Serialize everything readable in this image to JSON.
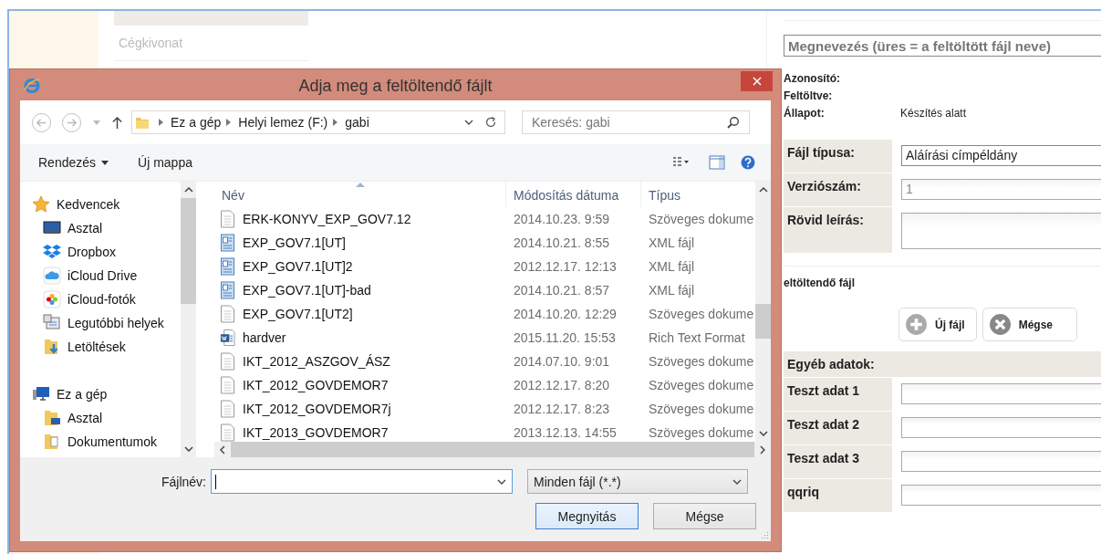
{
  "page": {
    "side_list": [
      {
        "label": "Cégkivonat"
      }
    ],
    "form": {
      "name_field": {
        "placeholder": "Megnevezés (üres = a feltöltött fájl neve)"
      },
      "info": [
        {
          "label": "Azonosító:"
        },
        {
          "label": "Feltöltve:"
        },
        {
          "label": "Állapot:",
          "value": "Készítés alatt"
        }
      ],
      "fields": [
        {
          "label": "Fájl típusa:",
          "kind": "select",
          "value": "Aláírási címpéldány"
        },
        {
          "label": "Verziószám:",
          "kind": "input",
          "value": "1"
        },
        {
          "label": "Rövid leírás:",
          "kind": "textarea"
        }
      ],
      "upload_label": "eltöltendő fájl",
      "upload_buttons": [
        {
          "label": "Új fájl",
          "kind": "add"
        },
        {
          "label": "Mégse",
          "kind": "cancel"
        }
      ],
      "extra_header": "Egyéb adatok:",
      "extra_fields": [
        {
          "label": "Teszt adat 1"
        },
        {
          "label": "Teszt adat 2"
        },
        {
          "label": "Teszt adat 3"
        },
        {
          "label": "qqriq"
        }
      ]
    }
  },
  "dialog": {
    "title": "Adja meg a feltöltendő fájlt",
    "breadcrumbs": [
      "Ez a gép",
      "Helyi lemez (F:)",
      "gabi"
    ],
    "search": {
      "placeholder": "Keresés: gabi"
    },
    "toolbar": [
      {
        "label": "Rendezés",
        "kind": "menu"
      },
      {
        "label": "Új mappa",
        "kind": "plain"
      }
    ],
    "nav": [
      {
        "label": "Kedvencek",
        "kind": "star",
        "children": [
          {
            "label": "Asztal",
            "kind": "desktop"
          },
          {
            "label": "Dropbox",
            "kind": "dropbox"
          },
          {
            "label": "iCloud Drive",
            "kind": "cloud"
          },
          {
            "label": "iCloud-fotók",
            "kind": "photos"
          },
          {
            "label": "Legutóbbi helyek",
            "kind": "recent"
          },
          {
            "label": "Letöltések",
            "kind": "downloads"
          }
        ]
      },
      {
        "label": "Ez a gép",
        "kind": "computer",
        "children": [
          {
            "label": "Asztal",
            "kind": "folder"
          },
          {
            "label": "Dokumentumok",
            "kind": "documents"
          }
        ]
      }
    ],
    "columns": [
      "Név",
      "Módosítás dátuma",
      "Típus"
    ],
    "files": [
      {
        "name": "ERK-KONYV_EXP_GOV7.12",
        "date": "2014.10.23. 9:59",
        "type": "Szöveges dokume",
        "kind": "text"
      },
      {
        "name": "EXP_GOV7.1[UT]",
        "date": "2014.10.21. 8:55",
        "type": "XML fájl",
        "kind": "xml"
      },
      {
        "name": "EXP_GOV7.1[UT]2",
        "date": "2012.12.17. 12:13",
        "type": "XML fájl",
        "kind": "xml"
      },
      {
        "name": "EXP_GOV7.1[UT]-bad",
        "date": "2014.10.21. 8:57",
        "type": "XML fájl",
        "kind": "xml"
      },
      {
        "name": "EXP_GOV7.1[UT2]",
        "date": "2014.10.20. 12:29",
        "type": "Szöveges dokume",
        "kind": "text"
      },
      {
        "name": "hardver",
        "date": "2015.11.20. 15:53",
        "type": "Rich Text Format",
        "kind": "word"
      },
      {
        "name": "IKT_2012_ASZGOV_ÁSZ",
        "date": "2014.07.10. 9:01",
        "type": "Szöveges dokume",
        "kind": "text"
      },
      {
        "name": "IKT_2012_GOVDEMOR7",
        "date": "2012.12.17. 8:20",
        "type": "Szöveges dokume",
        "kind": "text"
      },
      {
        "name": "IKT_2012_GOVDEMOR7j",
        "date": "2012.12.17. 8:23",
        "type": "Szöveges dokume",
        "kind": "text"
      },
      {
        "name": "IKT_2013_GOVDEMOR7",
        "date": "2013.12.13. 14:55",
        "type": "Szöveges dokume",
        "kind": "text"
      }
    ],
    "filename": {
      "label": "Fájlnév:"
    },
    "filter": "Minden fájl (*.*)",
    "buttons": [
      {
        "label": "Megnyitás",
        "default": true
      },
      {
        "label": "Mégse",
        "default": false
      }
    ]
  }
}
